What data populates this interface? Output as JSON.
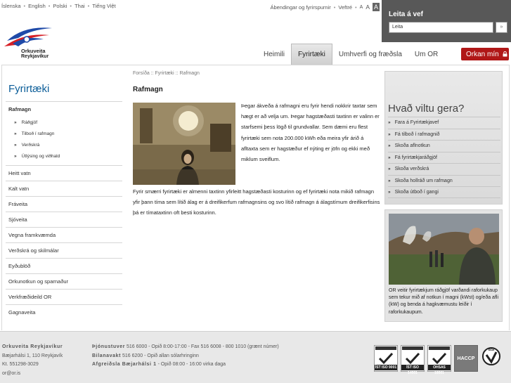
{
  "topbar": {
    "languages": [
      "Íslenska",
      "English",
      "Polski",
      "Thai",
      "Tiếng Việt"
    ],
    "feedback_link": "Ábendingar og fyrirspurnir",
    "help_link": "Veftré",
    "font_sizes": [
      "A",
      "A",
      "A"
    ]
  },
  "search": {
    "label": "Leita á vef",
    "value": "Leita",
    "go": "»"
  },
  "logo": {
    "line1": "Orkuveita",
    "line2": "Reykjavíkur"
  },
  "nav": {
    "items": [
      "Heimili",
      "Fyrirtæki",
      "Umhverfi og fræðsla",
      "Um OR"
    ],
    "active": "Fyrirtæki",
    "orkan_button": "Orkan mín"
  },
  "sidebar": {
    "heading": "Fyrirtæki",
    "current": "Rafmagn",
    "subitems": [
      "Ráðgjöf",
      "Tilboð í rafmagn",
      "Verðskrá",
      "Útlýsing og viðhald"
    ],
    "items": [
      "Heitt vatn",
      "Kalt vatn",
      "Fráveita",
      "Sjóveita",
      "Vegna framkvæmda",
      "Verðskrá og skilmálar",
      "Eyðublöð",
      "Orkunotkun og sparnaður",
      "Verkfræðideild OR",
      "Gagnaveita"
    ]
  },
  "main": {
    "breadcrumb": "Forsíða :: Fyrirtæki :: Rafmagn",
    "title": "Rafmagn",
    "paragraph1": "Þegar ákveða á rafmagni eru fyrir hendi nokkrir taxtar sem hægt er að velja um. Þegar hagstæðasti taxtinn er valinn er starfsemi þess lögð til grundvallar. Sem dæmi eru flest fyrirtæki sem nota 200.000 kWh eða meira yfir árið á afltaxta sem er hagstæður ef nýting er jöfn og ekki með miklum sveiflum.",
    "paragraph2": "Fyrir smærri fyrirtæki er almenni taxtinn yfirleitt hagstæðasti kosturinn og ef fyrirtæki nota mikið rafmagn yfir þann tíma sem lítið álag er á dreifikerfum rafmagnsins og svo lítið rafmagn á álagstímum dreifikerfisins þá er tímataxtinn oft besti kosturinn."
  },
  "right": {
    "heading": "Hvað viltu gera?",
    "links": [
      "Fara á Fyrirtækjavef",
      "Fá tilboð í rafmagnið",
      "Skoða aflnotkun",
      "Fá fyrirtækjaráðgjöf",
      "Skoða verðskrá",
      "Skoða hollráð um rafmagn",
      "Skoða útboð í gangi"
    ],
    "caption": "OR veitir fyrirtækjum ráðgjöf varðandi raforkukaup sem tekur mið af notkun í magni (kWst) og/eða afli (kW) og benda á hagkvæmustu leiðir í raforkukaupum."
  },
  "footer": {
    "company": "Orkuveita Reykjavíkur",
    "address": "Bæjarhálsi 1, 110 Reykjavík",
    "kt": "Kt. 551298-3029",
    "email": "or@or.is",
    "service_label": "Þjónustuver",
    "service_text": "516 6000 - Opið 8:00-17:00 - Fax 516 6008 - 800 1010 (grænt númer)",
    "switchboard_label": "Bilanavakt",
    "switchboard_text": "516 6200 - Opið allan sólarhringinn",
    "reception_label": "Afgreiðsla Bæjarhálsi 1",
    "reception_text": "- Opið 08:00 - 16:00 virka daga",
    "certs": [
      "ÍST ISO 9001",
      "ÍST ISO 14001",
      "OHSAS 18001"
    ],
    "haccp": "HACCP",
    "bsi": "BSI"
  }
}
